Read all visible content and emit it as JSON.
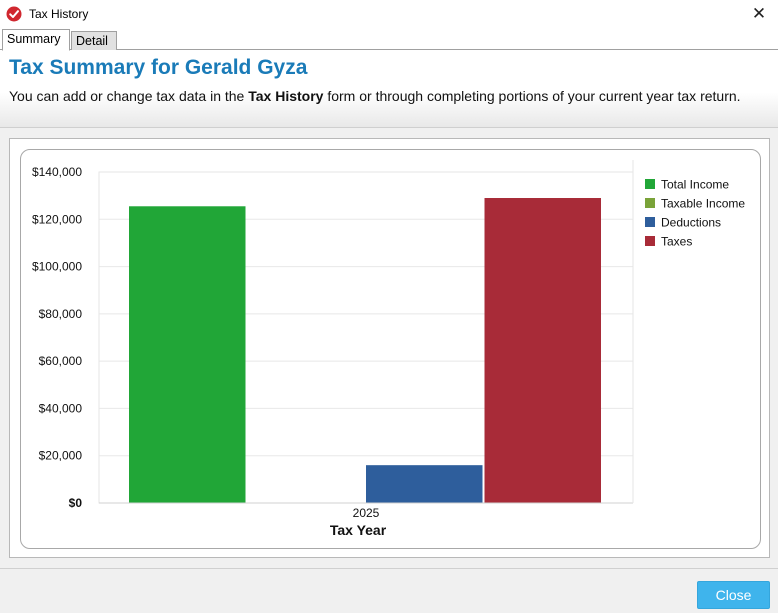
{
  "window": {
    "title": "Tax History",
    "app_icon": "red-checkmark-icon",
    "close_glyph": "✕"
  },
  "tabs": [
    {
      "label": "Summary",
      "active": true
    },
    {
      "label": "Detail",
      "active": false
    }
  ],
  "header": {
    "title": "Tax Summary for Gerald Gyza",
    "desc_pre": "You can add or change tax data in the ",
    "desc_bold": "Tax History",
    "desc_post": " form or through completing portions of your current year tax return."
  },
  "chart_data": {
    "type": "bar",
    "categories": [
      "2025"
    ],
    "xlabel": "Tax Year",
    "ylim": [
      0,
      140000
    ],
    "yticks": [
      0,
      20000,
      40000,
      60000,
      80000,
      100000,
      120000,
      140000
    ],
    "ytick_labels": [
      "$0",
      "$20,000",
      "$40,000",
      "$60,000",
      "$80,000",
      "$100,000",
      "$120,000",
      "$140,000"
    ],
    "grid": true,
    "legend_position": "right",
    "series": [
      {
        "name": "Total Income",
        "color": "#21a637",
        "values": [
          125500
        ]
      },
      {
        "name": "Taxable Income",
        "color": "#7aa339",
        "values": [
          0
        ]
      },
      {
        "name": "Deductions",
        "color": "#2e5e9c",
        "values": [
          16000
        ]
      },
      {
        "name": "Taxes",
        "color": "#a82b38",
        "values": [
          129000
        ]
      }
    ]
  },
  "footer": {
    "close_label": "Close"
  }
}
